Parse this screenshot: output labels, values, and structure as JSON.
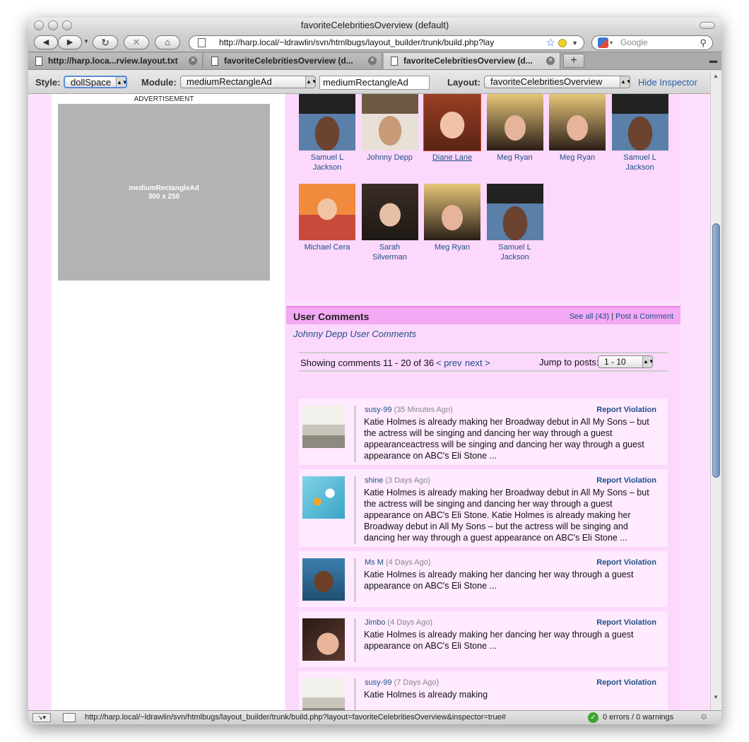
{
  "window": {
    "title": "favoriteCelebritiesOverview (default)"
  },
  "nav": {
    "url": "http://harp.local/~ldrawlin/svn/htmlbugs/layout_builder/trunk/build.php?lay",
    "search_placeholder": "Google"
  },
  "tabs": [
    {
      "label": "http://harp.loca...rview.layout.txt"
    },
    {
      "label": "favoriteCelebritiesOverview (d..."
    },
    {
      "label": "favoriteCelebritiesOverview (d..."
    }
  ],
  "inspector": {
    "style_label": "Style:",
    "style_value": "dollSpace",
    "module_label": "Module:",
    "module_value": "mediumRectangleAd",
    "module_input": "mediumRectangleAd",
    "layout_label": "Layout:",
    "layout_value": "favoriteCelebritiesOverview",
    "hide_link": "Hide Inspector"
  },
  "ad": {
    "caption": "ADVERTISEMENT",
    "name": "mediumRectangleAd",
    "size": "300 x 250"
  },
  "celebrities": [
    {
      "name": "Samuel L Jackson",
      "underlined": false
    },
    {
      "name": "Johnny Depp",
      "underlined": false
    },
    {
      "name": "Diane Lane",
      "underlined": true
    },
    {
      "name": "Meg Ryan",
      "underlined": false
    },
    {
      "name": "Meg Ryan",
      "underlined": false
    },
    {
      "name": "Samuel L Jackson",
      "underlined": false
    },
    {
      "name": "Michael Cera",
      "underlined": false
    },
    {
      "name": "Sarah Silverman",
      "underlined": false
    },
    {
      "name": "Meg Ryan",
      "underlined": false
    },
    {
      "name": "Samuel L Jackson",
      "underlined": false
    }
  ],
  "comments_section": {
    "header": "User Comments",
    "see_all": "See all (43)",
    "separator": "|",
    "post_link": "Post a Comment",
    "subtitle": "Johnny Depp User Comments",
    "showing": "Showing comments 11 - 20 of 36",
    "prev": "< prev",
    "next": "next >",
    "jump_label": "Jump to posts:",
    "jump_value": "1 - 10"
  },
  "comments": [
    {
      "user": "susy-99",
      "time": "(35 Minutes Ago)",
      "report": "Report Violation",
      "text": "Katie Holmes is already making her Broadway debut in All My Sons – but the actress will be singing and dancing her way through a guest appearanceactress will be singing and dancing her way through a guest appearance on ABC's Eli Stone ..."
    },
    {
      "user": "shine",
      "time": "(3 Days Ago)",
      "report": "Report Violation",
      "text": "Katie Holmes is already making her Broadway debut in All My Sons – but the actress will be singing and dancing her way through a guest appearance on ABC's Eli Stone. Katie Holmes is already making her Broadway debut in All My Sons – but the actress will be singing and dancing her way through a guest appearance on ABC's Eli Stone ..."
    },
    {
      "user": "Ms M",
      "time": "(4 Days Ago)",
      "report": "Report Violation",
      "text": "Katie Holmes is already making her dancing her way through a guest appearance on ABC's Eli Stone ..."
    },
    {
      "user": "Jimbo",
      "time": "(4 Days Ago)",
      "report": "Report Violation",
      "text": "Katie Holmes is already making her dancing her way through a guest appearance on ABC's Eli Stone ..."
    },
    {
      "user": "susy-99",
      "time": "(7 Days Ago)",
      "report": "Report Violation",
      "text": "Katie Holmes is already making"
    }
  ],
  "status": {
    "url": "http://harp.local/~ldrawlin/svn/htmlbugs/layout_builder/trunk/build.php?layout=favoriteCelebritiesOverview&inspector=true#",
    "errors": "0 errors / 0 warnings"
  }
}
